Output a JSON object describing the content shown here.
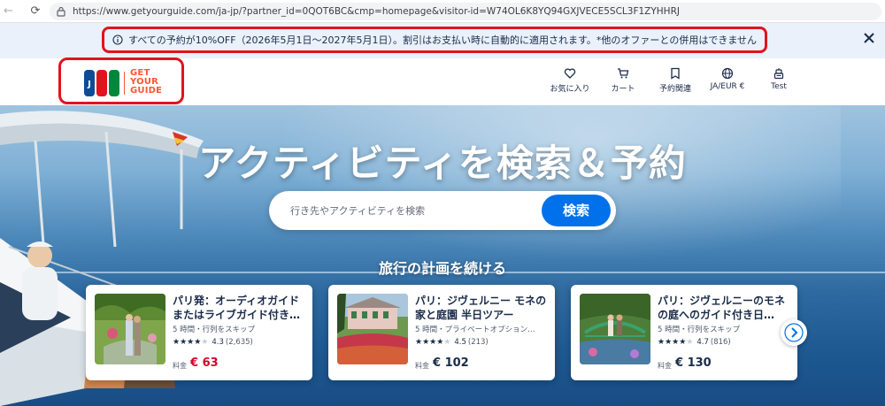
{
  "browser": {
    "url": "https://www.getyourguide.com/ja-jp/?partner_id=0QOT6BC&cmp=homepage&visitor-id=W74OL6K8YQ94GXJVECE5SCL3F1ZYHHRJ"
  },
  "promo": {
    "text": "すべての予約が10%OFF（2026年5月1日〜2027年5月1日）。割引はお支払い時に自動的に適用されます。*他のオファーとの併用はできません",
    "highlight_color": "#e0141e"
  },
  "header": {
    "logo": {
      "jcb": "JCB",
      "gyg_line1": "GET",
      "gyg_line2": "YOUR",
      "gyg_line3": "GUIDE"
    },
    "nav": [
      {
        "label": "お気に入り",
        "icon": "heart-icon"
      },
      {
        "label": "カート",
        "icon": "cart-icon"
      },
      {
        "label": "予約関連",
        "icon": "ticket-icon"
      },
      {
        "label": "JA/EUR €",
        "icon": "globe-icon"
      },
      {
        "label": "Test",
        "icon": "user-icon"
      }
    ]
  },
  "hero": {
    "title": "アクティビティを検索＆予約",
    "search_placeholder": "行き先やアクティビティを検索",
    "search_button": "検索",
    "section_title": "旅行の計画を続ける"
  },
  "cards": [
    {
      "title": "パリ発：オーディオガイドまたはライブガイド付き…",
      "meta": "5 時間・行列をスキップ",
      "stars_filled": 4,
      "rating": "4.3",
      "count": "(2,635)",
      "price_label": "料金",
      "price": "€ 63",
      "price_color": "#d9002b"
    },
    {
      "title": "パリ：ジヴェルニー モネの家と庭園 半日ツアー",
      "meta": "5 時間・プライベートオプション…",
      "stars_filled": 4.5,
      "rating": "4.5",
      "count": "(213)",
      "price_label": "料金",
      "price": "€ 102",
      "price_color": "#1a2b49"
    },
    {
      "title": "パリ：ジヴェルニーのモネの庭へのガイド付き日…",
      "meta": "5 時間・行列をスキップ",
      "stars_filled": 4.5,
      "rating": "4.7",
      "count": "(816)",
      "price_label": "料金",
      "price": "€ 130",
      "price_color": "#1a2b49"
    }
  ],
  "colors": {
    "brand_blue": "#0071eb",
    "gyg_orange": "#ff5533",
    "text_dark": "#1a2b49"
  }
}
